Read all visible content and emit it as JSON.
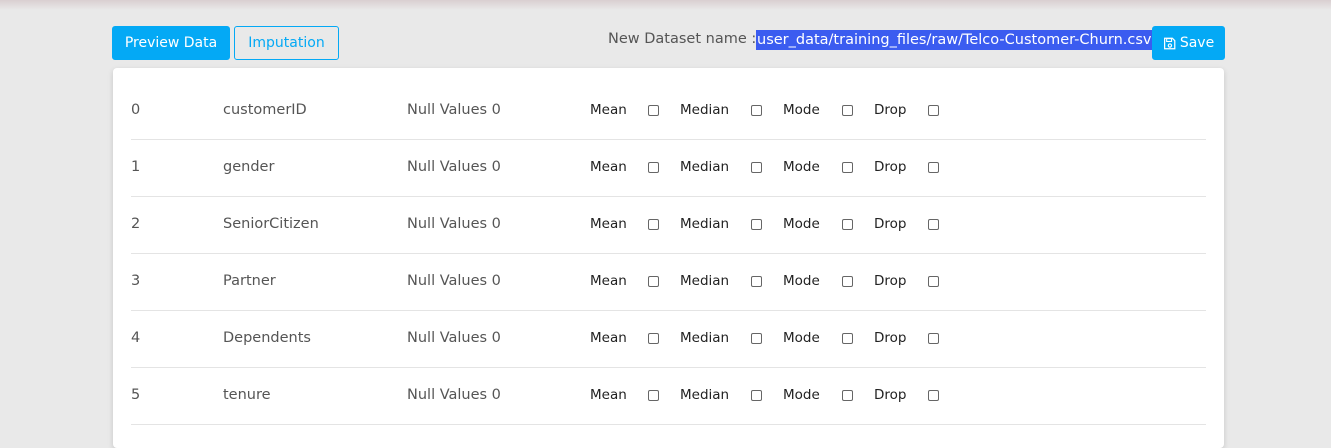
{
  "toolbar": {
    "preview_label": "Preview Data",
    "imputation_label": "Imputation",
    "dataset_label": "New Dataset name :",
    "dataset_name": "user_data/training_files/raw/Telco-Customer-Churn.csv",
    "save_label": "Save",
    "save_icon": "floppy-disk-icon"
  },
  "options": {
    "mean": "Mean",
    "median": "Median",
    "mode": "Mode",
    "drop": "Drop"
  },
  "rows": [
    {
      "index": "0",
      "name": "customerID",
      "nulls": "Null Values 0"
    },
    {
      "index": "1",
      "name": "gender",
      "nulls": "Null Values 0"
    },
    {
      "index": "2",
      "name": "SeniorCitizen",
      "nulls": "Null Values 0"
    },
    {
      "index": "3",
      "name": "Partner",
      "nulls": "Null Values 0"
    },
    {
      "index": "4",
      "name": "Dependents",
      "nulls": "Null Values 0"
    },
    {
      "index": "5",
      "name": "tenure",
      "nulls": "Null Values 0"
    }
  ],
  "colors": {
    "accent": "#04a9f5",
    "selection": "#3b5cf0",
    "background": "#e9e9e9"
  }
}
